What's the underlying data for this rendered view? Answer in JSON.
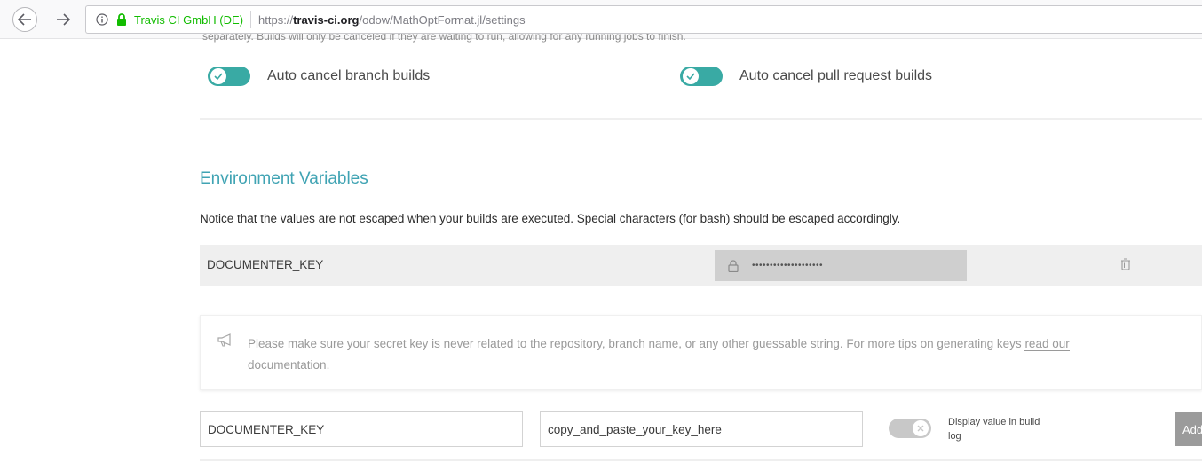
{
  "browser": {
    "org_name": "Travis CI GmbH (DE)",
    "url_prefix": "https://",
    "url_host": "travis-ci.org",
    "url_path": "/odow/MathOptFormat.jl/settings"
  },
  "auto_cancel": {
    "clipped_text": "separately. Builds will only be canceled if they are waiting to run, allowing for any running jobs to finish.",
    "branch_label": "Auto cancel branch builds",
    "branch_enabled": true,
    "pr_label": "Auto cancel pull request builds",
    "pr_enabled": true
  },
  "env_vars": {
    "title": "Environment Variables",
    "notice": "Notice that the values are not escaped when your builds are executed. Special characters (for bash) should be escaped accordingly.",
    "rows": [
      {
        "name": "DOCUMENTER_KEY",
        "value": "••••••••••••••••••••"
      }
    ]
  },
  "tip": {
    "text": "Please make sure your secret key is never related to the repository, branch name, or any other guessable string. For more tips on generating keys ",
    "link_text_1": "read our",
    "link_text_2": "documentation",
    "end": "."
  },
  "new_var": {
    "name_value": "DOCUMENTER_KEY",
    "value_value": "copy_and_paste_your_key_here",
    "display_toggle_on": false,
    "display_label": "Display value in build log",
    "add_label": "Add"
  },
  "colors": {
    "accent": "#39aaa4",
    "title": "#3fa3b3",
    "secure_green": "#12bc00"
  }
}
